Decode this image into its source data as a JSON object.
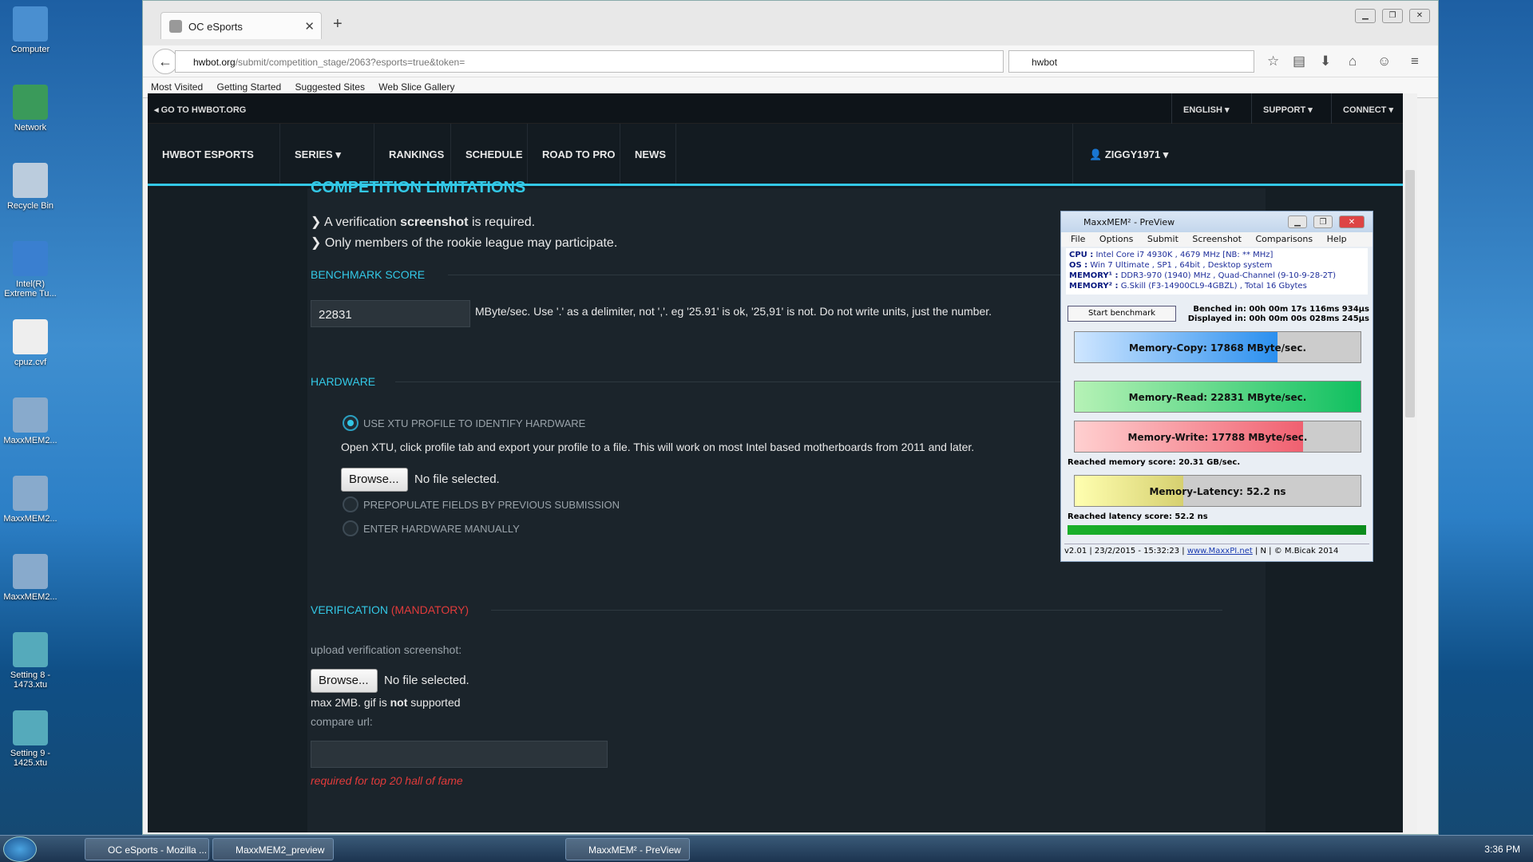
{
  "desktop_icons": [
    {
      "label": "Computer",
      "color": "#4a8fd0"
    },
    {
      "label": "Network",
      "color": "#3a9a5a"
    },
    {
      "label": "Recycle Bin",
      "color": "#bcd"
    },
    {
      "label": "Intel(R) Extreme Tu...",
      "color": "#3a7fd0"
    },
    {
      "label": "cpuz.cvf",
      "color": "#eee"
    },
    {
      "label": "MaxxMEM2...",
      "color": "#8ac"
    },
    {
      "label": "MaxxMEM2...",
      "color": "#8ac"
    },
    {
      "label": "MaxxMEM2...",
      "color": "#8ac"
    },
    {
      "label": "Setting 8 - 1473.xtu",
      "color": "#5ab"
    },
    {
      "label": "Setting 9 - 1425.xtu",
      "color": "#5ab"
    }
  ],
  "browser": {
    "tab_title": "OC eSports",
    "url_host": "hwbot.org",
    "url_path": "/submit/competition_stage/2063?esports=true&token=",
    "search_value": "hwbot",
    "bookmarks": [
      "Most Visited",
      "Getting Started",
      "Suggested Sites",
      "Web Slice Gallery"
    ]
  },
  "site": {
    "goto": "GO TO HWBOT.ORG",
    "top_menu": [
      "ENGLISH",
      "SUPPORT",
      "CONNECT"
    ],
    "nav": [
      "HWBOT ESPORTS",
      "SERIES",
      "RANKINGS",
      "SCHEDULE",
      "ROAD TO PRO",
      "NEWS"
    ],
    "user": "ZIGGY1971",
    "heading": "COMPETITION LIMITATIONS",
    "limit1_pre": "A verification ",
    "limit1_bold": "screenshot",
    "limit1_post": " is required.",
    "limit2": "Only members of the rookie league may participate.",
    "benchmark_label": "BENCHMARK SCORE",
    "score_value": "22831",
    "score_help": "MByte/sec.  Use '.' as a delimiter, not ','. eg '25.91' is ok, '25,91' is not. Do not write units, just the number.",
    "hardware_label": "HARDWARE",
    "opt_xtu": "USE XTU PROFILE TO IDENTIFY HARDWARE",
    "xtu_help": "Open XTU, click profile tab and export your profile to a file. This will work on most Intel based motherboards from 2011 and later.",
    "browse": "Browse...",
    "no_file": "No file selected.",
    "opt_prev": "PREPOPULATE FIELDS BY PREVIOUS SUBMISSION",
    "opt_manual": "ENTER HARDWARE MANUALLY",
    "verification_label": "VERIFICATION",
    "mandatory": "(MANDATORY)",
    "upload_label": "upload verification screenshot:",
    "max_pre": "max 2MB. gif is ",
    "max_bold": "not",
    "max_post": " supported",
    "compare_label": "compare url:",
    "required_note": "required for top 20 hall of fame"
  },
  "maxxmem": {
    "title": "MaxxMEM² - PreView",
    "menu": [
      "File",
      "Options",
      "Submit",
      "Screenshot",
      "Comparisons",
      "Help"
    ],
    "cpu_k": "CPU :",
    "cpu": "Intel Core i7 4930K , 4679 MHz  [NB: ** MHz]",
    "os_k": "OS :",
    "os": "Win 7 Ultimate , SP1 , 64bit , Desktop system",
    "mem1_k": "MEMORY¹ :",
    "mem1": "DDR3-970 (1940) MHz , Quad-Channel (9-10-9-28-2T)",
    "mem2_k": "MEMORY² :",
    "mem2": "G.Skill (F3-14900CL9-4GBZL) , Total 16 Gbytes",
    "start": "Start benchmark",
    "benched": "Benched in: 00h 00m 17s 116ms 934µs",
    "displayed": "Displayed in: 00h 00m 00s 028ms 245µs",
    "copy": "Memory-Copy: 17868 MByte/sec.",
    "copy_pct": 0.71,
    "read": "Memory-Read: 22831 MByte/sec.",
    "read_pct": 1.0,
    "write": "Memory-Write: 17788 MByte/sec.",
    "write_pct": 0.8,
    "mem_score": "Reached memory score: 20.31 GB/sec.",
    "latency": "Memory-Latency: 52.2 ns",
    "latency_pct": 0.38,
    "lat_score": "Reached latency score: 52.2 ns",
    "version": "v2.01",
    "date": "23/2/2015 - 15:32:23",
    "site": "www.MaxxPI.net",
    "n": "N",
    "copyright": "© M.Bicak 2014"
  },
  "taskbar": {
    "items": [
      "OC eSports - Mozilla ...",
      "MaxxMEM2_preview",
      "MaxxMEM² - PreView"
    ],
    "clock": "3:36 PM"
  }
}
